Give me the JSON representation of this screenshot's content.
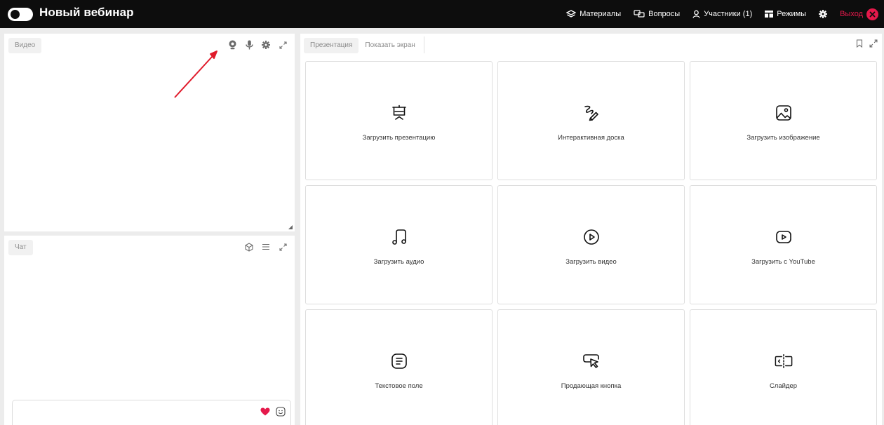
{
  "header": {
    "title": "Новый вебинар",
    "nav": {
      "materials": "Материалы",
      "questions": "Вопросы",
      "participants": "Участники (1)",
      "modes": "Режимы",
      "exit": "Выход"
    }
  },
  "video_panel": {
    "label": "Видео"
  },
  "chat_panel": {
    "label": "Чат"
  },
  "presentation": {
    "tabs": [
      "Презентация",
      "Показать экран"
    ],
    "cards": [
      {
        "label": "Загрузить презентацию",
        "icon": "presentation-icon"
      },
      {
        "label": "Интерактивная доска",
        "icon": "whiteboard-icon"
      },
      {
        "label": "Загрузить изображение",
        "icon": "image-icon"
      },
      {
        "label": "Загрузить аудио",
        "icon": "music-note-icon"
      },
      {
        "label": "Загрузить видео",
        "icon": "play-circle-icon"
      },
      {
        "label": "Загрузить с YouTube",
        "icon": "youtube-icon"
      },
      {
        "label": "Текстовое поле",
        "icon": "text-field-icon"
      },
      {
        "label": "Продающая кнопка",
        "icon": "cursor-button-icon"
      },
      {
        "label": "Слайдер",
        "icon": "slider-icon"
      }
    ]
  },
  "colors": {
    "accent": "#e5194b",
    "topbar": "#0d0d0d",
    "annotation_arrow": "#e01b2b"
  }
}
